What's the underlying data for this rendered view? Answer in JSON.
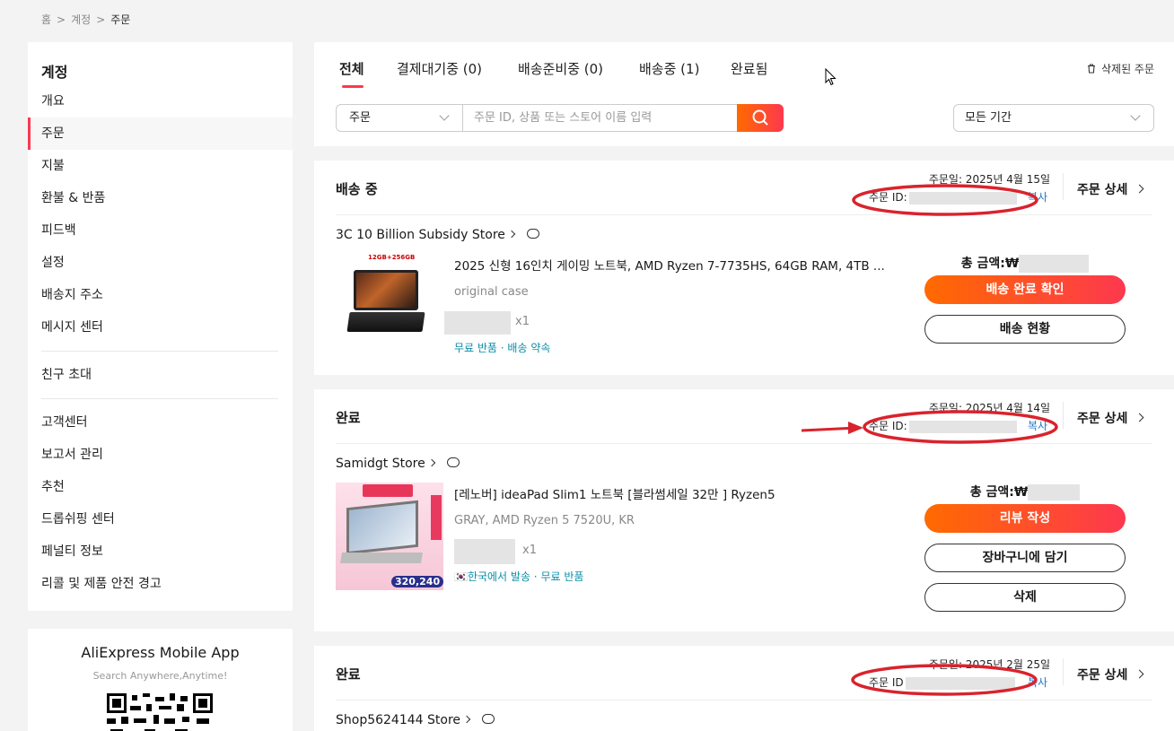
{
  "breadcrumb": {
    "home": "홈",
    "account": "계정",
    "current": "주문"
  },
  "sidebar": {
    "title": "계정",
    "items": [
      {
        "label": "개요"
      },
      {
        "label": "주문"
      },
      {
        "label": "지불"
      },
      {
        "label": "환불 & 반품"
      },
      {
        "label": "피드백"
      },
      {
        "label": "설정"
      },
      {
        "label": "배송지 주소"
      },
      {
        "label": "메시지 센터"
      },
      {
        "label": "친구 초대"
      },
      {
        "label": "고객센터"
      },
      {
        "label": "보고서 관리"
      },
      {
        "label": "추천"
      },
      {
        "label": "드롭쉬핑 센터"
      },
      {
        "label": "페널티 정보"
      },
      {
        "label": "리콜 및 제품 안전 경고"
      }
    ]
  },
  "app_promo": {
    "title": "AliExpress Mobile App",
    "subtitle": "Search Anywhere,Anytime!"
  },
  "tabs": [
    {
      "label": "전체"
    },
    {
      "label": "결제대기중 (0)"
    },
    {
      "label": "배송준비중 (0)"
    },
    {
      "label": "배송중 (1)"
    },
    {
      "label": "완료됨"
    }
  ],
  "deleted_orders": "삭제된 주문",
  "search": {
    "scope": "주문",
    "placeholder": "주문 ID, 상품 또는 스토어 이름 입력",
    "period": "모든 기간"
  },
  "orders": [
    {
      "status": "배송 중",
      "date": "주문일: 2025년 4월 15일",
      "id_label": "주문 ID:",
      "copy": "복사",
      "detail": "주문 상세",
      "store": "3C 10 Billion Subsidy Store",
      "title": "2025 신형 16인치 게이밍 노트북, AMD Ryzen 7-7735HS, 64GB RAM, 4TB ...",
      "sku": "original case",
      "qty": "x1",
      "tags": "무료 반품 · 배송 약속",
      "img_label": "12GB+256GB",
      "total_label": "총 금액:₩",
      "btn1": "배송 완료 확인",
      "btn2": "배송 현황"
    },
    {
      "status": "완료",
      "date": "주문일: 2025년 4월 14일",
      "id_label": "주문 ID:",
      "copy": "복사",
      "detail": "주문 상세",
      "store": "Samidgt Store",
      "title": "[레노버] ideaPad Slim1 노트북 [블라썸세일 32만 ] Ryzen5",
      "sku": "GRAY, AMD Ryzen 5 7520U, KR",
      "qty": "x1",
      "tags": "🇰🇷한국에서 발송 · 무료 반품",
      "img_price": "320,240",
      "total_label": "총 금액:₩",
      "btn1": "리뷰 작성",
      "btn2": "장바구니에 담기",
      "btn3": "삭제"
    },
    {
      "status": "완료",
      "date": "주문일: 2025년 2월 25일",
      "id_label": "주문 ID",
      "copy": "복사",
      "detail": "주문 상세",
      "store": "Shop5624144 Store"
    }
  ],
  "colors": {
    "accent": "#fd384f",
    "accent2": "#ff6a00",
    "annotation": "#d9232d",
    "link": "#2277cc"
  }
}
